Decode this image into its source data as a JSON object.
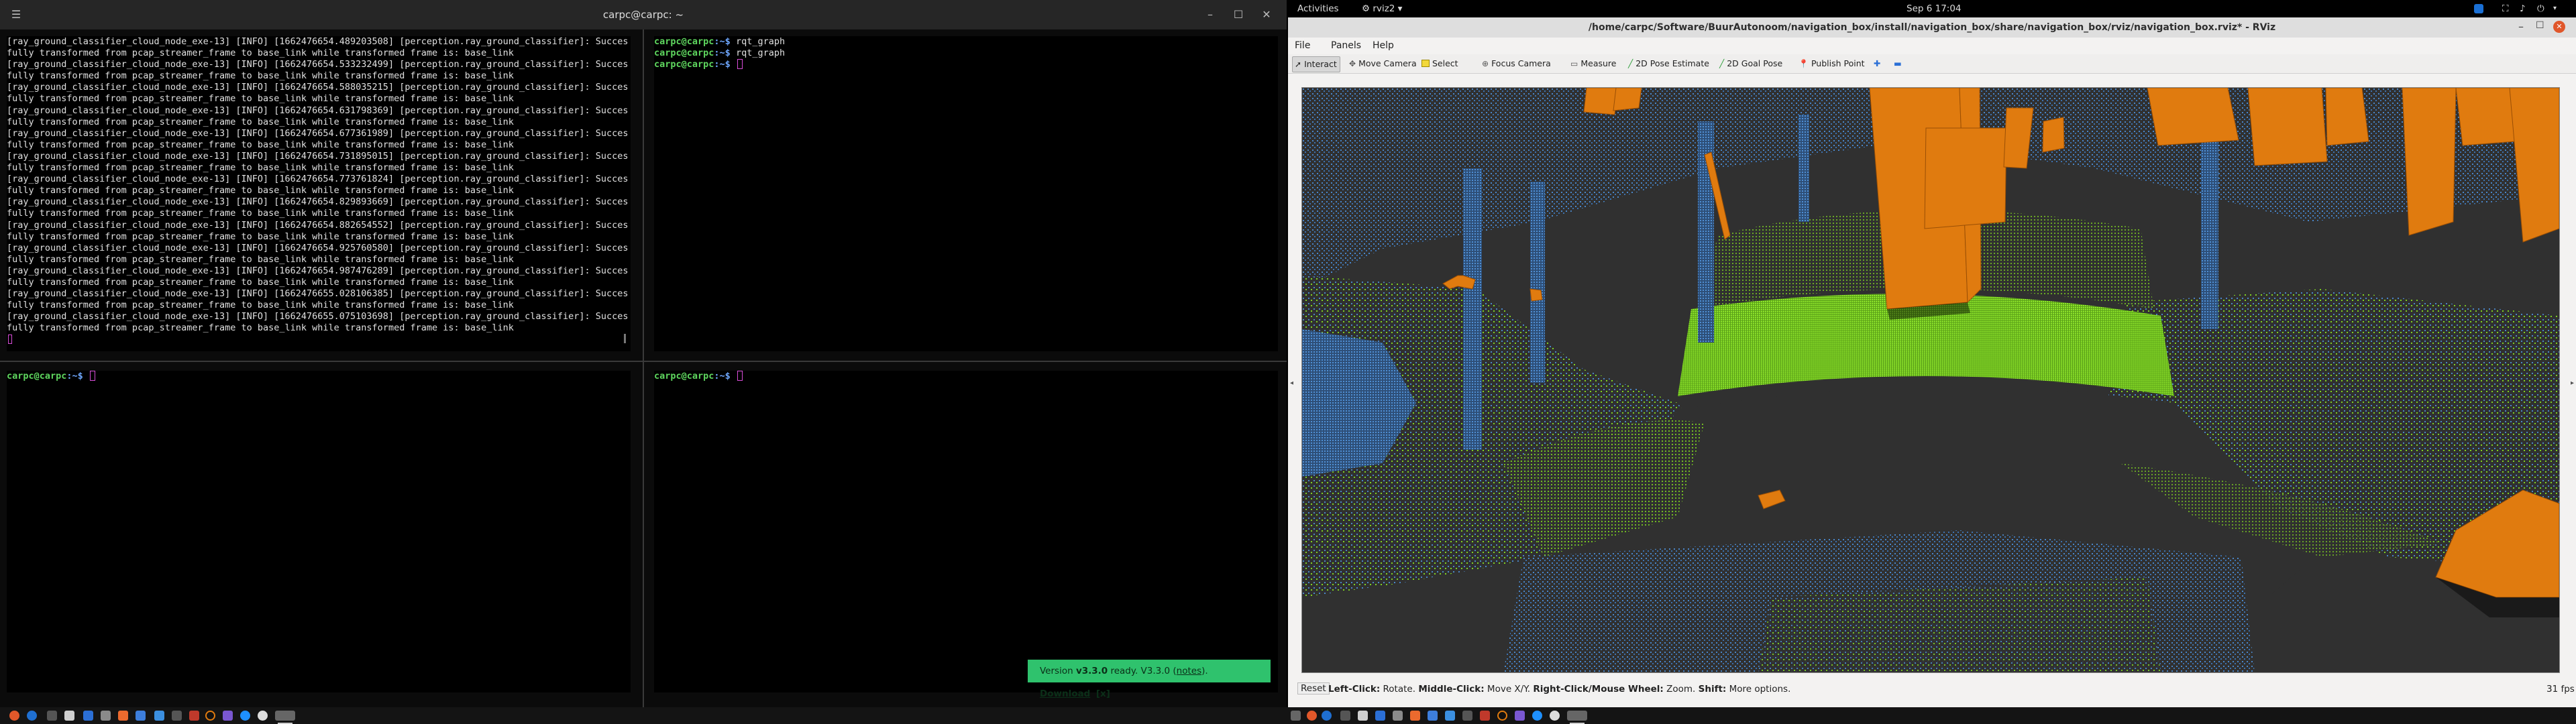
{
  "terminal": {
    "title": "carpc@carpc: ~",
    "top_left_lines": [
      "[ray_ground_classifier_cloud_node_exe-13] [INFO] [1662476654.489203508] [perception.ray_ground_classifier]: Succes",
      "fully transformed from pcap_streamer_frame to base_link while transformed frame is: base_link",
      "[ray_ground_classifier_cloud_node_exe-13] [INFO] [1662476654.533232499] [perception.ray_ground_classifier]: Succes",
      "fully transformed from pcap_streamer_frame to base_link while transformed frame is: base_link",
      "[ray_ground_classifier_cloud_node_exe-13] [INFO] [1662476654.588035215] [perception.ray_ground_classifier]: Succes",
      "fully transformed from pcap_streamer_frame to base_link while transformed frame is: base_link",
      "[ray_ground_classifier_cloud_node_exe-13] [INFO] [1662476654.631798369] [perception.ray_ground_classifier]: Succes",
      "fully transformed from pcap_streamer_frame to base_link while transformed frame is: base_link",
      "[ray_ground_classifier_cloud_node_exe-13] [INFO] [1662476654.677361989] [perception.ray_ground_classifier]: Succes",
      "fully transformed from pcap_streamer_frame to base_link while transformed frame is: base_link",
      "[ray_ground_classifier_cloud_node_exe-13] [INFO] [1662476654.731895015] [perception.ray_ground_classifier]: Succes",
      "fully transformed from pcap_streamer_frame to base_link while transformed frame is: base_link",
      "[ray_ground_classifier_cloud_node_exe-13] [INFO] [1662476654.773761824] [perception.ray_ground_classifier]: Succes",
      "fully transformed from pcap_streamer_frame to base_link while transformed frame is: base_link",
      "[ray_ground_classifier_cloud_node_exe-13] [INFO] [1662476654.829893669] [perception.ray_ground_classifier]: Succes",
      "fully transformed from pcap_streamer_frame to base_link while transformed frame is: base_link",
      "[ray_ground_classifier_cloud_node_exe-13] [INFO] [1662476654.882654552] [perception.ray_ground_classifier]: Succes",
      "fully transformed from pcap_streamer_frame to base_link while transformed frame is: base_link",
      "[ray_ground_classifier_cloud_node_exe-13] [INFO] [1662476654.925760580] [perception.ray_ground_classifier]: Succes",
      "fully transformed from pcap_streamer_frame to base_link while transformed frame is: base_link",
      "[ray_ground_classifier_cloud_node_exe-13] [INFO] [1662476654.987476289] [perception.ray_ground_classifier]: Succes",
      "fully transformed from pcap_streamer_frame to base_link while transformed frame is: base_link",
      "[ray_ground_classifier_cloud_node_exe-13] [INFO] [1662476655.028106385] [perception.ray_ground_classifier]: Succes",
      "fully transformed from pcap_streamer_frame to base_link while transformed frame is: base_link",
      "[ray_ground_classifier_cloud_node_exe-13] [INFO] [1662476655.075103698] [perception.ray_ground_classifier]: Succes",
      "fully transformed from pcap_streamer_frame to base_link while transformed frame is: base_link"
    ],
    "prompt_user": "carpc@carpc",
    "prompt_path": ":~$",
    "top_right_commands": [
      "rqt_graph",
      "rqt_graph"
    ],
    "notification": {
      "prefix": "Version ",
      "version": "v3.3.0",
      "ready": " ready. V3.3.0 (",
      "notes": "notes",
      "close_paren": "). ",
      "download": "Download",
      "close": "[x]"
    }
  },
  "gnome": {
    "activities": "Activities",
    "app_name": "rviz2",
    "datetime": "Sep 6  17:04"
  },
  "rviz": {
    "title": "/home/carpc/Software/BuurAutonoom/navigation_box/install/navigation_box/share/navigation_box/rviz/navigation_box.rviz* - RViz",
    "menu": [
      "File",
      "Panels",
      "Help"
    ],
    "tools": [
      "Interact",
      "Move Camera",
      "Select",
      "Focus Camera",
      "Measure",
      "2D Pose Estimate",
      "2D Goal Pose",
      "Publish Point"
    ],
    "status": {
      "reset": "Reset",
      "left_click": "Left-Click:",
      "left_click_desc": " Rotate. ",
      "middle_click": "Middle-Click:",
      "middle_click_desc": " Move X/Y. ",
      "right_click": "Right-Click/Mouse Wheel:",
      "right_click_desc": " Zoom. ",
      "shift": "Shift:",
      "shift_desc": " More options.",
      "fps": "31 fps"
    }
  },
  "colors": {
    "ground_points": "#7ed321",
    "object_points": "#4a86c8",
    "boxes": "#e07b0f",
    "notify_bg": "#2fc26d"
  }
}
